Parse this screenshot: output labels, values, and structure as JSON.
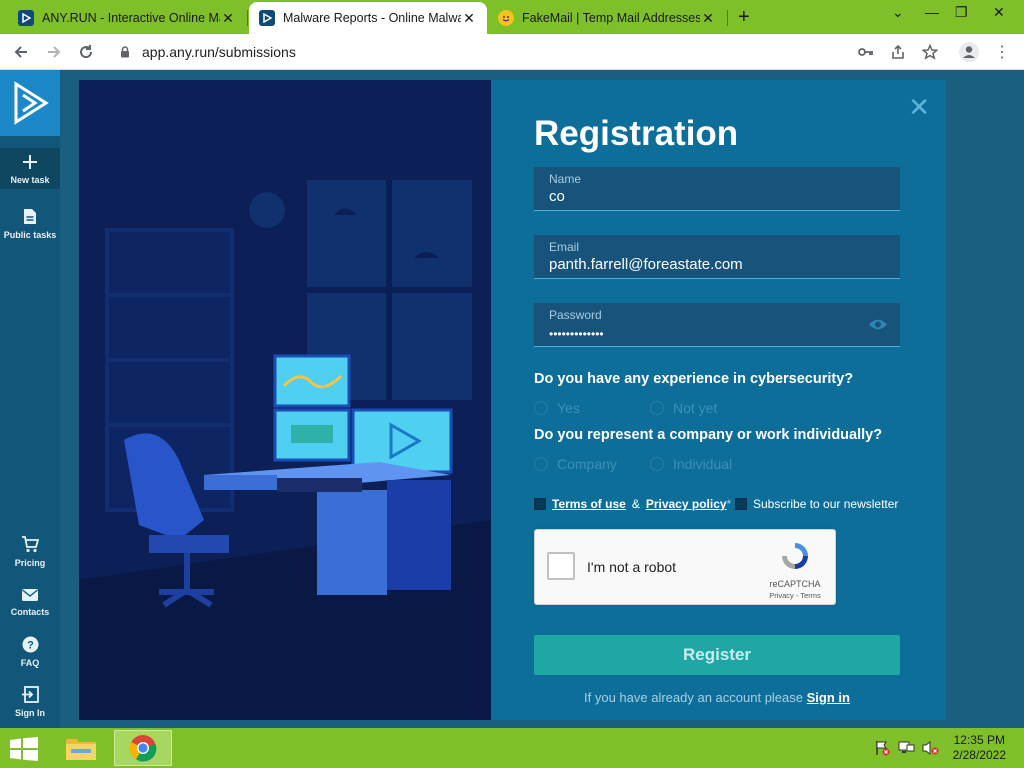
{
  "browser": {
    "tabs": [
      {
        "title": "ANY.RUN - Interactive Online Ma",
        "active": false
      },
      {
        "title": "Malware Reports - Online Malwa",
        "active": true
      },
      {
        "title": "FakeMail | Temp Mail Addresses",
        "active": false
      }
    ],
    "url": "app.any.run/submissions"
  },
  "sidebar": {
    "new_task": "New task",
    "public_tasks": "Public tasks",
    "pricing": "Pricing",
    "contacts": "Contacts",
    "faq": "FAQ",
    "sign_in": "Sign In"
  },
  "modal": {
    "title": "Registration",
    "name": {
      "label": "Name",
      "value": "co"
    },
    "email": {
      "label": "Email",
      "value": "panth.farrell@foreastate.com"
    },
    "password": {
      "label": "Password",
      "value": "•••••••••••••"
    },
    "q1": {
      "text": "Do you have any experience in cybersecurity?",
      "options": [
        "Yes",
        "Not yet"
      ]
    },
    "q2": {
      "text": "Do you represent a company or work individually?",
      "options": [
        "Company",
        "Individual"
      ]
    },
    "terms_link": "Terms of use",
    "and": "&",
    "privacy_link": "Privacy policy",
    "required_mark": "*",
    "newsletter": "Subscribe to our newsletter",
    "recaptcha": {
      "label": "I'm not a robot",
      "brand": "reCAPTCHA",
      "links": "Privacy - Terms"
    },
    "register_button": "Register",
    "signin_prompt": "If you have already an account please",
    "signin_link": "Sign in"
  },
  "taskbar": {
    "time": "12:35 PM",
    "date": "2/28/2022"
  },
  "colors": {
    "accent": "#1ea7a4",
    "brand_blue": "#1d88c7",
    "taskbar": "#7fbf2a"
  }
}
